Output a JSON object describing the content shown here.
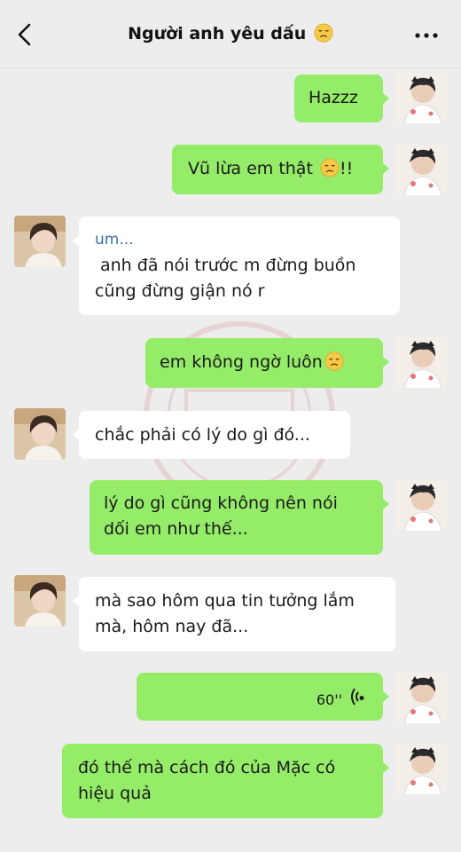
{
  "header": {
    "title": "Người anh yêu dấu"
  },
  "messages": [
    {
      "side": "me",
      "lines": [
        "Hazzz"
      ]
    },
    {
      "side": "me",
      "lines": [
        "Vũ lừa em thật",
        "!!"
      ]
    },
    {
      "side": "other",
      "quote": "um...",
      "lines": [
        "anh đã nói trước m đừng buồn",
        "cũng đừng giận nó r"
      ]
    },
    {
      "side": "me",
      "lines": [
        "em không ngờ luôn"
      ]
    },
    {
      "side": "other",
      "lines": [
        "chắc phải có lý do gì đó..."
      ]
    },
    {
      "side": "me",
      "lines": [
        "lý do gì cũng không nên nói",
        "dối em như thế..."
      ]
    },
    {
      "side": "other",
      "lines": [
        "mà sao hôm qua tin tưởng lắm",
        "mà, hôm nay đã..."
      ]
    },
    {
      "side": "me",
      "type": "voice",
      "duration": "60''"
    },
    {
      "side": "me",
      "lines": [
        "đó thế mà cách đó của Mặc có",
        "hiệu quả"
      ]
    }
  ],
  "icons": {
    "back": "chevron-left-icon",
    "more": "more-dots-icon",
    "emoji": "disappointed-face-emoji",
    "voice": "voice-wave-icon"
  },
  "colors": {
    "sent_bubble": "#95ec69",
    "received_bubble": "#ffffff",
    "background": "#ededed",
    "quote_text": "#3d6ea8"
  }
}
